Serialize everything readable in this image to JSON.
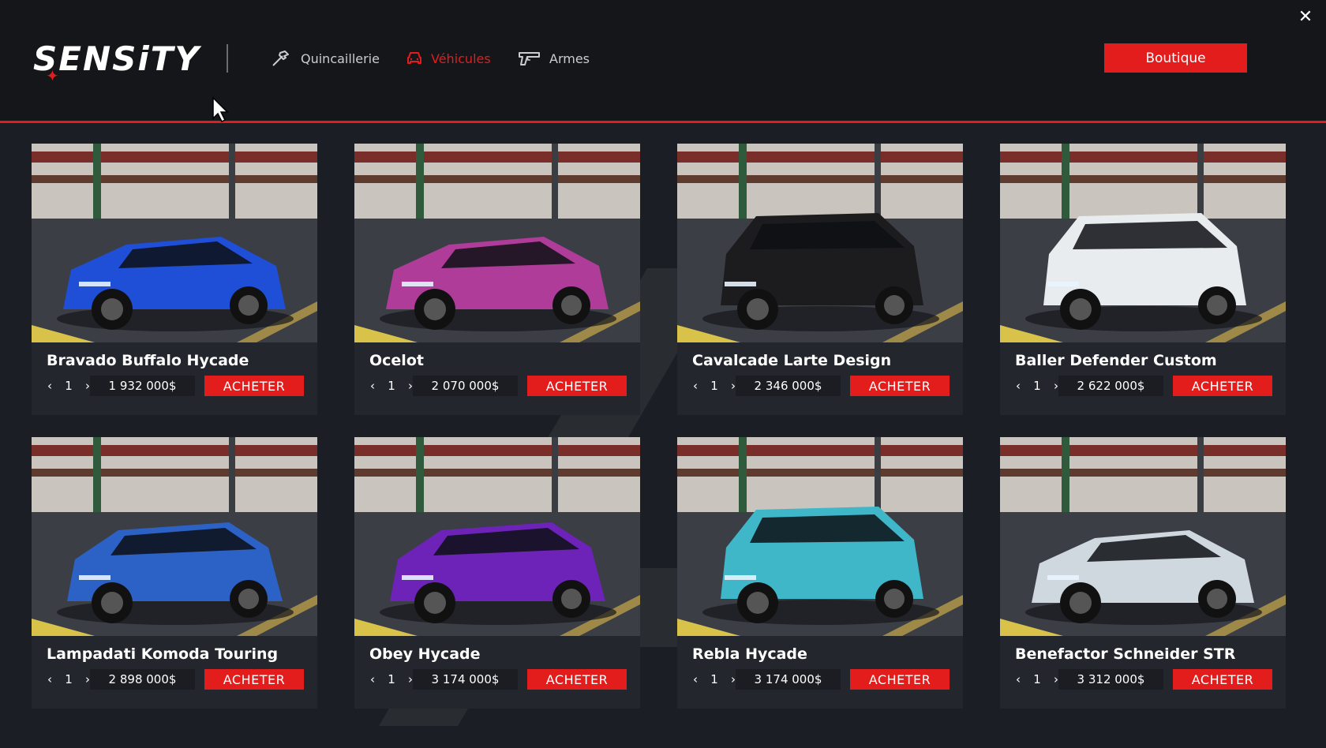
{
  "header": {
    "logo_text": "SENSiTY",
    "nav": [
      {
        "label": "Quincaillerie",
        "icon": "hammer-icon",
        "active": false
      },
      {
        "label": "Véhicules",
        "icon": "car-icon",
        "active": true
      },
      {
        "label": "Armes",
        "icon": "gun-icon",
        "active": false
      }
    ],
    "boutique_label": "Boutique",
    "close_icon": "close-icon"
  },
  "colors": {
    "accent": "#e31c1c",
    "background": "#1b1e24",
    "header_bg": "#14161a",
    "card_bg": "#23262c"
  },
  "vehicles": [
    {
      "name": "Bravado Buffalo Hycade",
      "qty": "1",
      "price": "1 932 000$",
      "buy_label": "ACHETER",
      "car_color": "#1f4fd6",
      "car_style": "sedan"
    },
    {
      "name": "Ocelot",
      "qty": "1",
      "price": "2 070 000$",
      "buy_label": "ACHETER",
      "car_color": "#b03c9a",
      "car_style": "sedan"
    },
    {
      "name": "Cavalcade Larte Design",
      "qty": "1",
      "price": "2 346 000$",
      "buy_label": "ACHETER",
      "car_color": "#1c1c1f",
      "car_style": "suv"
    },
    {
      "name": "Baller Defender Custom",
      "qty": "1",
      "price": "2 622 000$",
      "buy_label": "ACHETER",
      "car_color": "#e9ecef",
      "car_style": "suv"
    },
    {
      "name": "Lampadati Komoda Touring",
      "qty": "1",
      "price": "2 898 000$",
      "buy_label": "ACHETER",
      "car_color": "#2c62c6",
      "car_style": "wagon"
    },
    {
      "name": "Obey Hycade",
      "qty": "1",
      "price": "3 174 000$",
      "buy_label": "ACHETER",
      "car_color": "#6d22b8",
      "car_style": "wagon"
    },
    {
      "name": "Rebla Hycade",
      "qty": "1",
      "price": "3 174 000$",
      "buy_label": "ACHETER",
      "car_color": "#3fb7c9",
      "car_style": "suv"
    },
    {
      "name": "Benefactor Schneider STR",
      "qty": "1",
      "price": "3 312 000$",
      "buy_label": "ACHETER",
      "car_color": "#cfd8de",
      "car_style": "sedan"
    }
  ],
  "qty_prev_icon": "chevron-left-icon",
  "qty_next_icon": "chevron-right-icon"
}
